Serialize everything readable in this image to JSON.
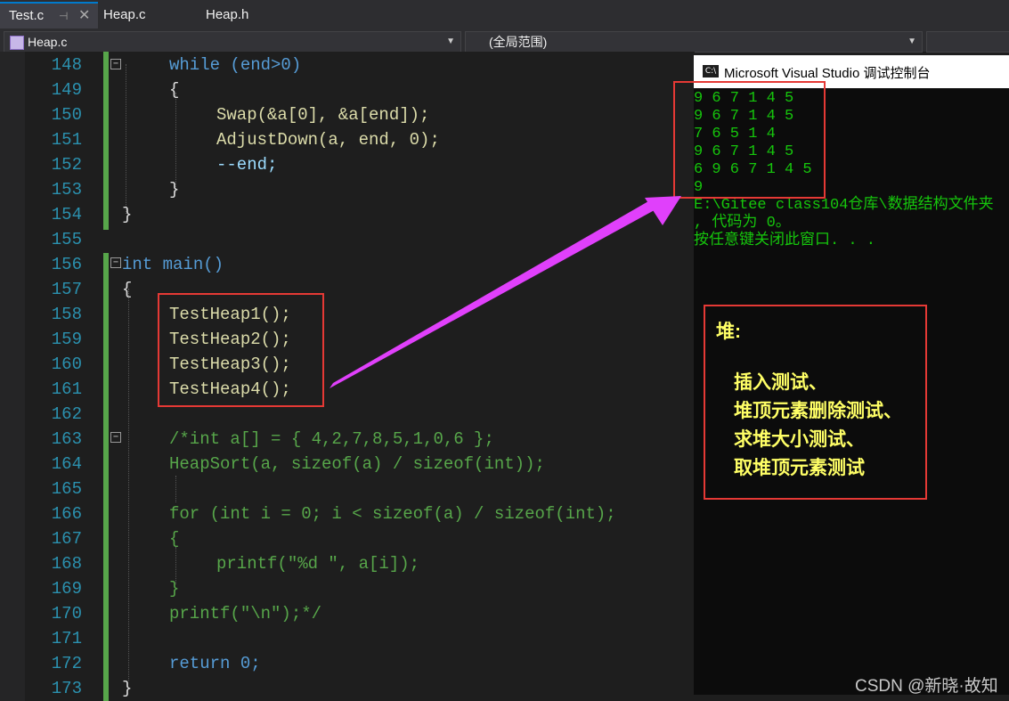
{
  "tabs": [
    {
      "label": "Test.c",
      "active": true
    },
    {
      "label": "Heap.c",
      "active": false
    },
    {
      "label": "Heap.h",
      "active": false
    }
  ],
  "navbar": {
    "file": "Heap.c",
    "scope": "(全局范围)"
  },
  "code_lines": [
    {
      "num": "148",
      "text": "while (end>0)"
    },
    {
      "num": "149",
      "text": "{"
    },
    {
      "num": "150",
      "text": "Swap(&a[0], &a[end]);"
    },
    {
      "num": "151",
      "text": "AdjustDown(a, end, 0);"
    },
    {
      "num": "152",
      "text": "--end;"
    },
    {
      "num": "153",
      "text": "}"
    },
    {
      "num": "154",
      "text": "}"
    },
    {
      "num": "155",
      "text": ""
    },
    {
      "num": "156",
      "text": "int main()"
    },
    {
      "num": "157",
      "text": "{"
    },
    {
      "num": "158",
      "text": "TestHeap1();"
    },
    {
      "num": "159",
      "text": "TestHeap2();"
    },
    {
      "num": "160",
      "text": "TestHeap3();"
    },
    {
      "num": "161",
      "text": "TestHeap4();"
    },
    {
      "num": "162",
      "text": ""
    },
    {
      "num": "163",
      "text": "/*int a[] = { 4,2,7,8,5,1,0,6 };"
    },
    {
      "num": "164",
      "text": "HeapSort(a, sizeof(a) / sizeof(int));"
    },
    {
      "num": "165",
      "text": ""
    },
    {
      "num": "166",
      "text": "for (int i = 0; i < sizeof(a) / sizeof(int);"
    },
    {
      "num": "167",
      "text": "{"
    },
    {
      "num": "168",
      "text": "printf(\"%d \", a[i]);"
    },
    {
      "num": "169",
      "text": "}"
    },
    {
      "num": "170",
      "text": "printf(\"\\n\");*/"
    },
    {
      "num": "171",
      "text": ""
    },
    {
      "num": "172",
      "text": "return 0;"
    },
    {
      "num": "173",
      "text": "}"
    }
  ],
  "console": {
    "title": "Microsoft Visual Studio 调试控制台",
    "icon_text": "C:\\",
    "lines": [
      "9 6 7 1 4 5",
      "9 6 7 1 4 5",
      "7 6 5 1 4",
      "9 6 7 1 4 5",
      "6 9 6 7 1 4 5",
      "9",
      "E:\\Gitee class104仓库\\数据结构文件夹",
      ", 代码为 0。",
      "按任意键关闭此窗口. . ."
    ]
  },
  "annotation": {
    "title": "堆:",
    "items": [
      "插入测试、",
      "堆顶元素删除测试、",
      "求堆大小测试、",
      "取堆顶元素测试"
    ]
  },
  "watermark": "CSDN @新晓·故知",
  "colors": {
    "highlight_box": "#e53935",
    "arrow": "#e040fb",
    "console_text": "#16c60c",
    "annotation_text": "#ffff66"
  }
}
